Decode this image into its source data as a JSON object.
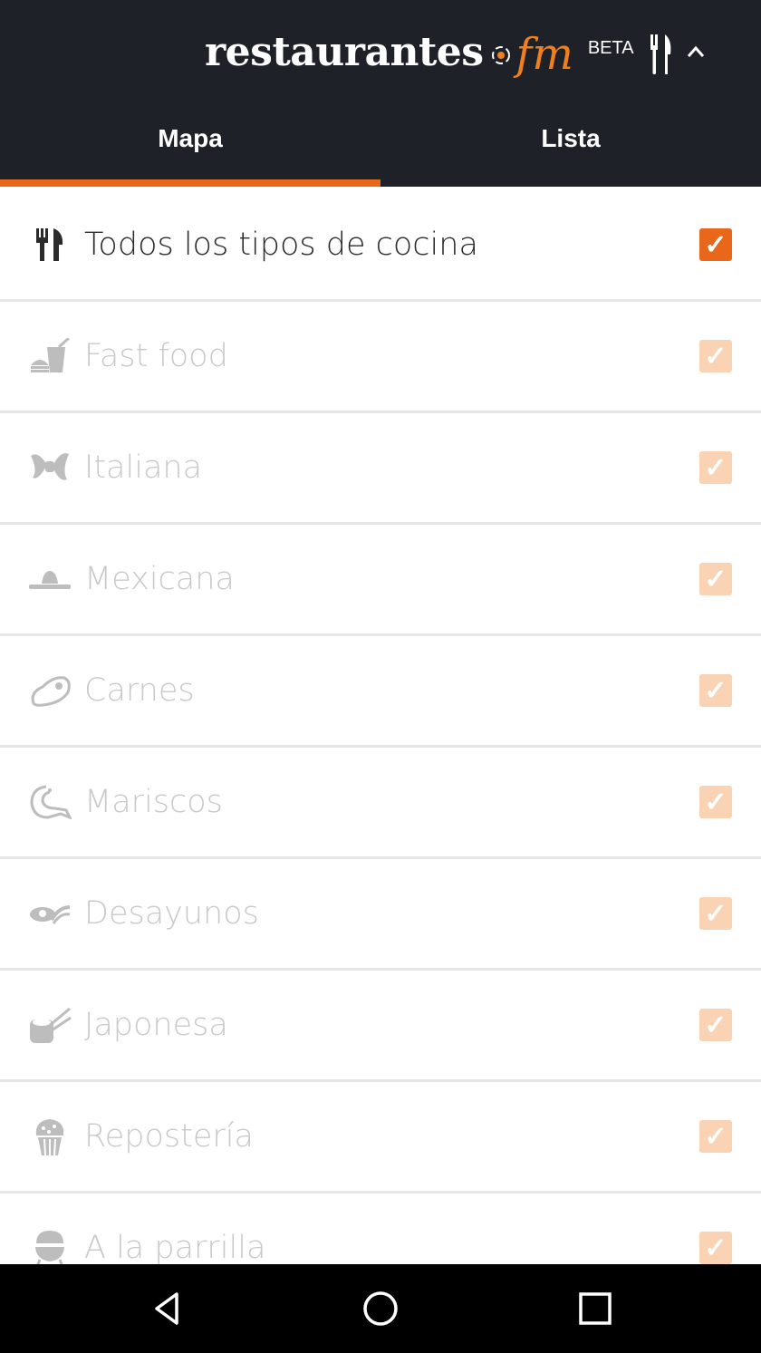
{
  "header": {
    "brand_word": "restaurantes",
    "brand_fm": "fm",
    "beta": "BETA",
    "icons": [
      "cutlery-icon",
      "chevron-up-icon"
    ]
  },
  "tabs": [
    {
      "label": "Mapa",
      "selected": true
    },
    {
      "label": "Lista",
      "selected": false
    }
  ],
  "cuisines": [
    {
      "label": "Todos los tipos de cocina",
      "icon": "cutlery-icon",
      "checked": true
    },
    {
      "label": "Fast food",
      "icon": "fast-food-icon",
      "checked": true
    },
    {
      "label": "Italiana",
      "icon": "pasta-icon",
      "checked": true
    },
    {
      "label": "Mexicana",
      "icon": "sombrero-icon",
      "checked": true
    },
    {
      "label": "Carnes",
      "icon": "steak-icon",
      "checked": true
    },
    {
      "label": "Mariscos",
      "icon": "shrimp-icon",
      "checked": true
    },
    {
      "label": "Desayunos",
      "icon": "breakfast-icon",
      "checked": true
    },
    {
      "label": "Japonesa",
      "icon": "sushi-icon",
      "checked": true
    },
    {
      "label": "Repostería",
      "icon": "cupcake-icon",
      "checked": true
    },
    {
      "label": "A la parrilla",
      "icon": "grill-icon",
      "checked": true
    }
  ],
  "colors": {
    "header_bg": "#1f2128",
    "accent": "#e8671b",
    "check_dim": "#fad3b4"
  },
  "navbar": [
    "back-icon",
    "home-icon",
    "recents-icon"
  ]
}
